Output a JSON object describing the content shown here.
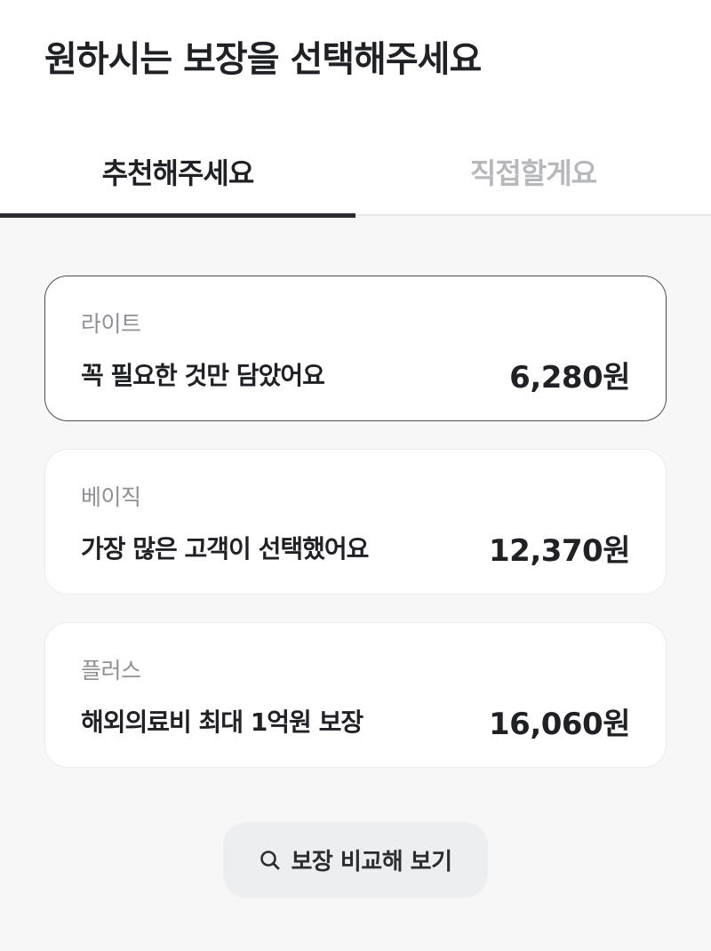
{
  "header": {
    "title": "원하시는 보장을 선택해주세요"
  },
  "tabs": [
    {
      "label": "추천해주세요",
      "active": true
    },
    {
      "label": "직접할게요",
      "active": false
    }
  ],
  "plans": [
    {
      "tier": "라이트",
      "description": "꼭 필요한 것만 담았어요",
      "price": "6,280원",
      "selected": true
    },
    {
      "tier": "베이직",
      "description": "가장 많은 고객이 선택했어요",
      "price": "12,370원",
      "selected": false
    },
    {
      "tier": "플러스",
      "description": "해외의료비 최대 1억원 보장",
      "price": "16,060원",
      "selected": false
    }
  ],
  "compare_button": {
    "icon": "search-icon",
    "label": "보장 비교해 보기"
  },
  "colors": {
    "background": "#f7f7f8",
    "text_primary": "#1f2125",
    "text_secondary": "#8d9095",
    "tab_inactive": "#b6b8bc",
    "selected_border": "#4a4c51",
    "button_bg": "#eceef0"
  }
}
